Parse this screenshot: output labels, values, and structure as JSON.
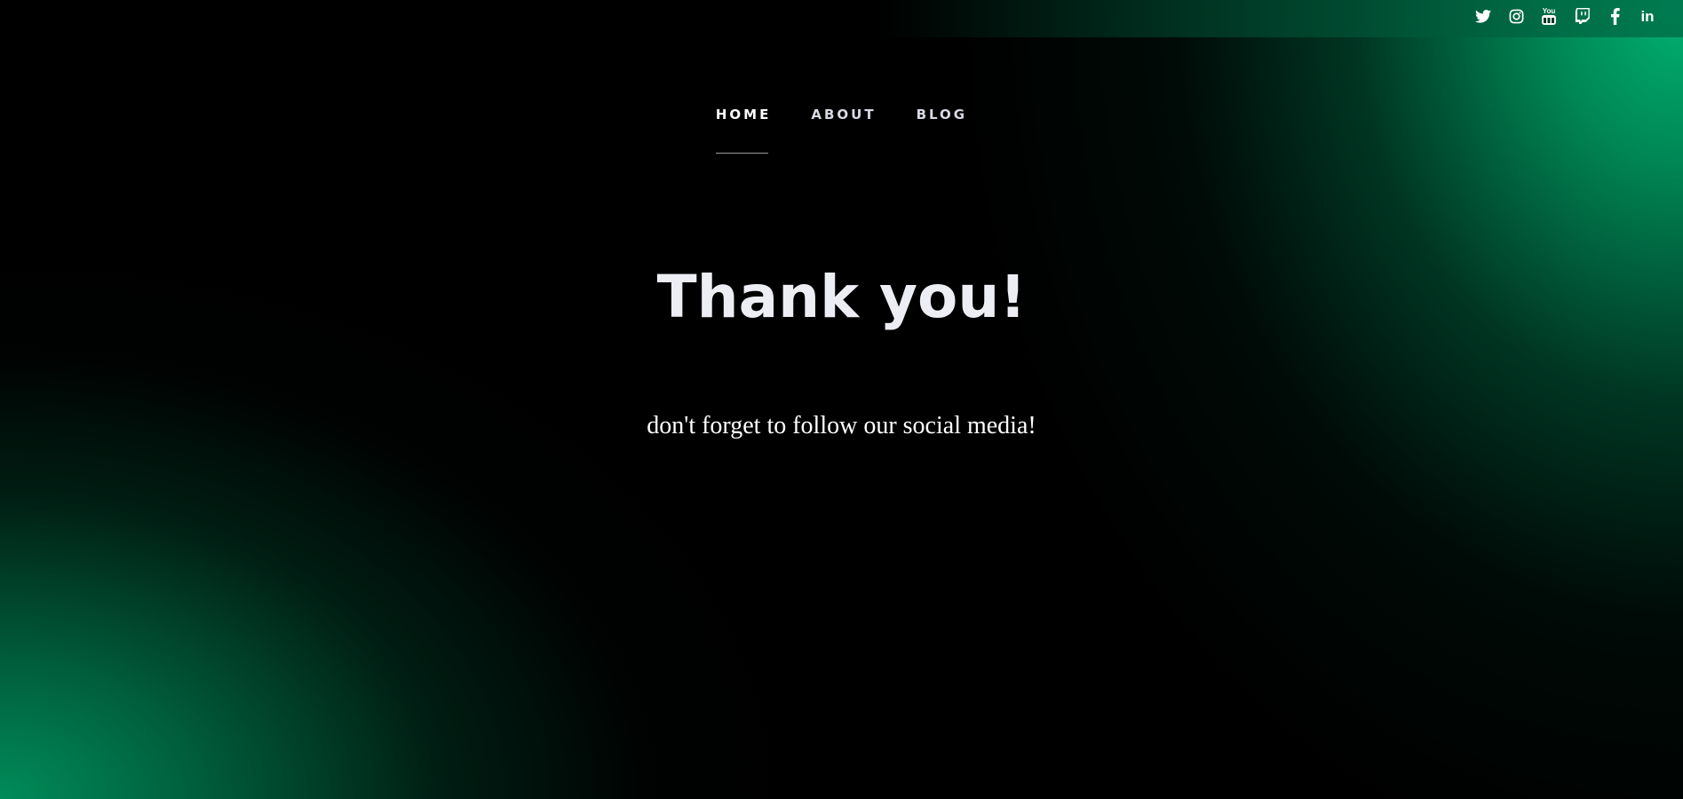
{
  "social": {
    "icons": [
      "twitter-icon",
      "instagram-icon",
      "youtube-icon",
      "twitch-icon",
      "facebook-icon",
      "linkedin-icon"
    ],
    "youtube_label": "You",
    "linkedin_label": "in"
  },
  "nav": {
    "home": "HOME",
    "about": "ABOUT",
    "blog": "BLOG",
    "active": "home"
  },
  "hero": {
    "title": "Thank you!",
    "subtitle": "don't forget to follow our social media!"
  },
  "colors": {
    "background": "#000000",
    "accent_green": "#00b273",
    "text": "#eceef4"
  }
}
